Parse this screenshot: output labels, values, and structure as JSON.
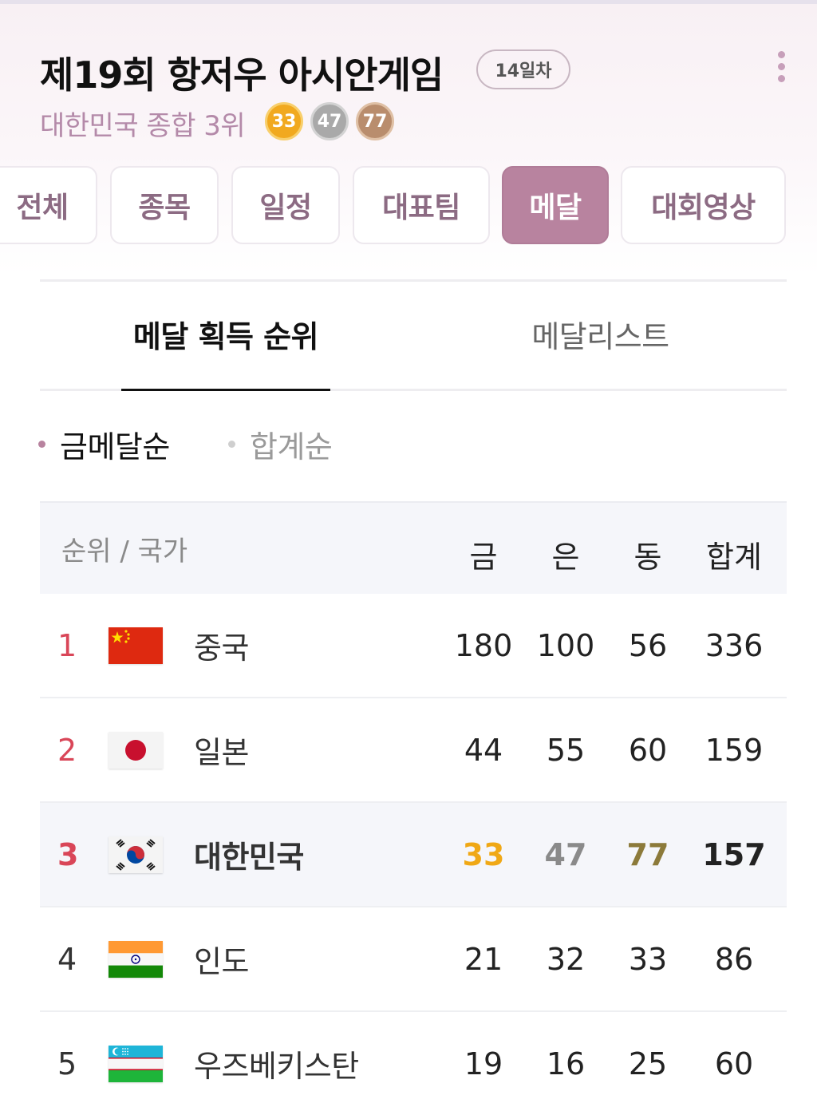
{
  "header": {
    "title": "제19회 항저우 아시안게임",
    "day_badge": "14일차",
    "summary": "대한민국 종합 3위",
    "medals": {
      "gold": "33",
      "silver": "47",
      "bronze": "77"
    },
    "more_icon": "more-vertical-icon"
  },
  "category_tabs": [
    "전체",
    "종목",
    "일정",
    "대표팀",
    "메달",
    "대회영상"
  ],
  "active_category": "메달",
  "sub_tabs": {
    "ranking": "메달 획득 순위",
    "list": "메달리스트"
  },
  "sort_options": {
    "gold": "금메달순",
    "total": "합계순"
  },
  "table": {
    "headers": {
      "country": "순위 / 국가",
      "gold": "금",
      "silver": "은",
      "bronze": "동",
      "total": "합계"
    },
    "rows": [
      {
        "rank": "1",
        "country": "중국",
        "gold": "180",
        "silver": "100",
        "bronze": "56",
        "total": "336"
      },
      {
        "rank": "2",
        "country": "일본",
        "gold": "44",
        "silver": "55",
        "bronze": "60",
        "total": "159"
      },
      {
        "rank": "3",
        "country": "대한민국",
        "gold": "33",
        "silver": "47",
        "bronze": "77",
        "total": "157"
      },
      {
        "rank": "4",
        "country": "인도",
        "gold": "21",
        "silver": "32",
        "bronze": "33",
        "total": "86"
      },
      {
        "rank": "5",
        "country": "우즈베키스탄",
        "gold": "19",
        "silver": "16",
        "bronze": "25",
        "total": "60"
      }
    ]
  },
  "colors": {
    "accent": "#b8839f",
    "rank_top": "#d94658",
    "gold": "#f0a815",
    "silver": "#8a8a8a",
    "bronze": "#8c7a3a"
  }
}
